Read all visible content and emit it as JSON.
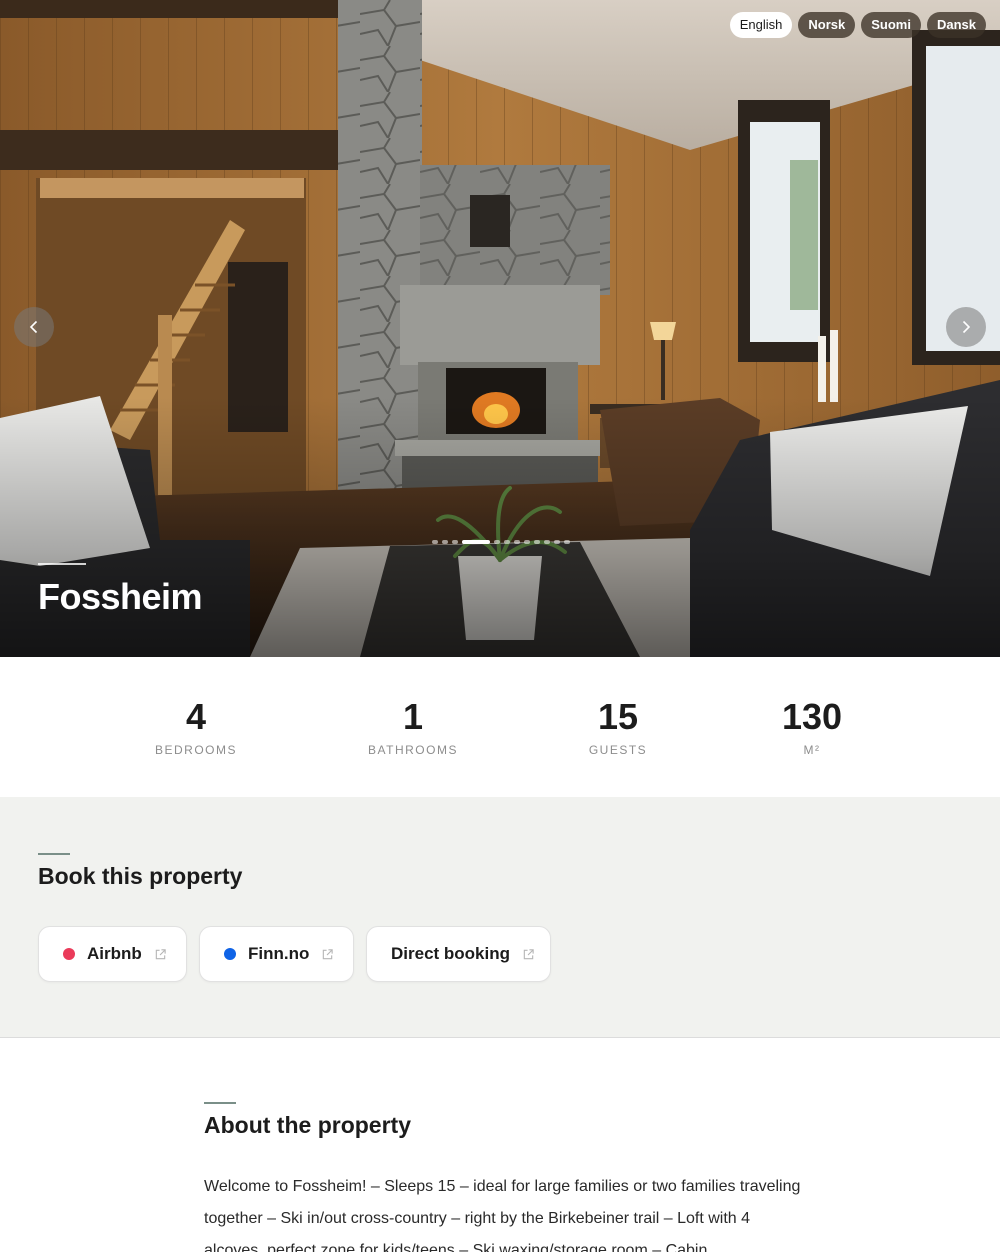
{
  "hero": {
    "title": "Fossheim",
    "languages": [
      {
        "label": "English",
        "active": true
      },
      {
        "label": "Norsk",
        "active": false
      },
      {
        "label": "Suomi",
        "active": false
      },
      {
        "label": "Dansk",
        "active": false
      }
    ],
    "slide_count": 12,
    "active_slide": 3,
    "prev_icon": "chevron-left-icon",
    "next_icon": "chevron-right-icon"
  },
  "stats": [
    {
      "value": "4",
      "label": "BEDROOMS"
    },
    {
      "value": "1",
      "label": "BATHROOMS"
    },
    {
      "value": "15",
      "label": "GUESTS"
    },
    {
      "value": "130",
      "label": "M²"
    }
  ],
  "booking": {
    "title": "Book this property",
    "options": [
      {
        "label": "Airbnb",
        "dot_color": "#ea3b5a",
        "icon": "external-link-icon"
      },
      {
        "label": "Finn.no",
        "dot_color": "#0f63e6",
        "icon": "external-link-icon"
      },
      {
        "label": "Direct booking",
        "dot_color": "",
        "icon": "external-link-icon"
      }
    ]
  },
  "about": {
    "title": "About the property",
    "description": "Welcome to Fossheim! – Sleeps 15 – ideal for large families or two families traveling together – Ski in/out cross-country – right by the Birkebeiner trail – Loft with 4 alcoves, perfect zone for kids/teens – Ski waxing/storage room – Cabin"
  },
  "colors": {
    "page_bg": "#ffffff",
    "booking_bg": "#f1f2ef",
    "accent_rule": "#7a8f88",
    "text": "#1c1c1c",
    "muted": "#8d8d8d"
  }
}
